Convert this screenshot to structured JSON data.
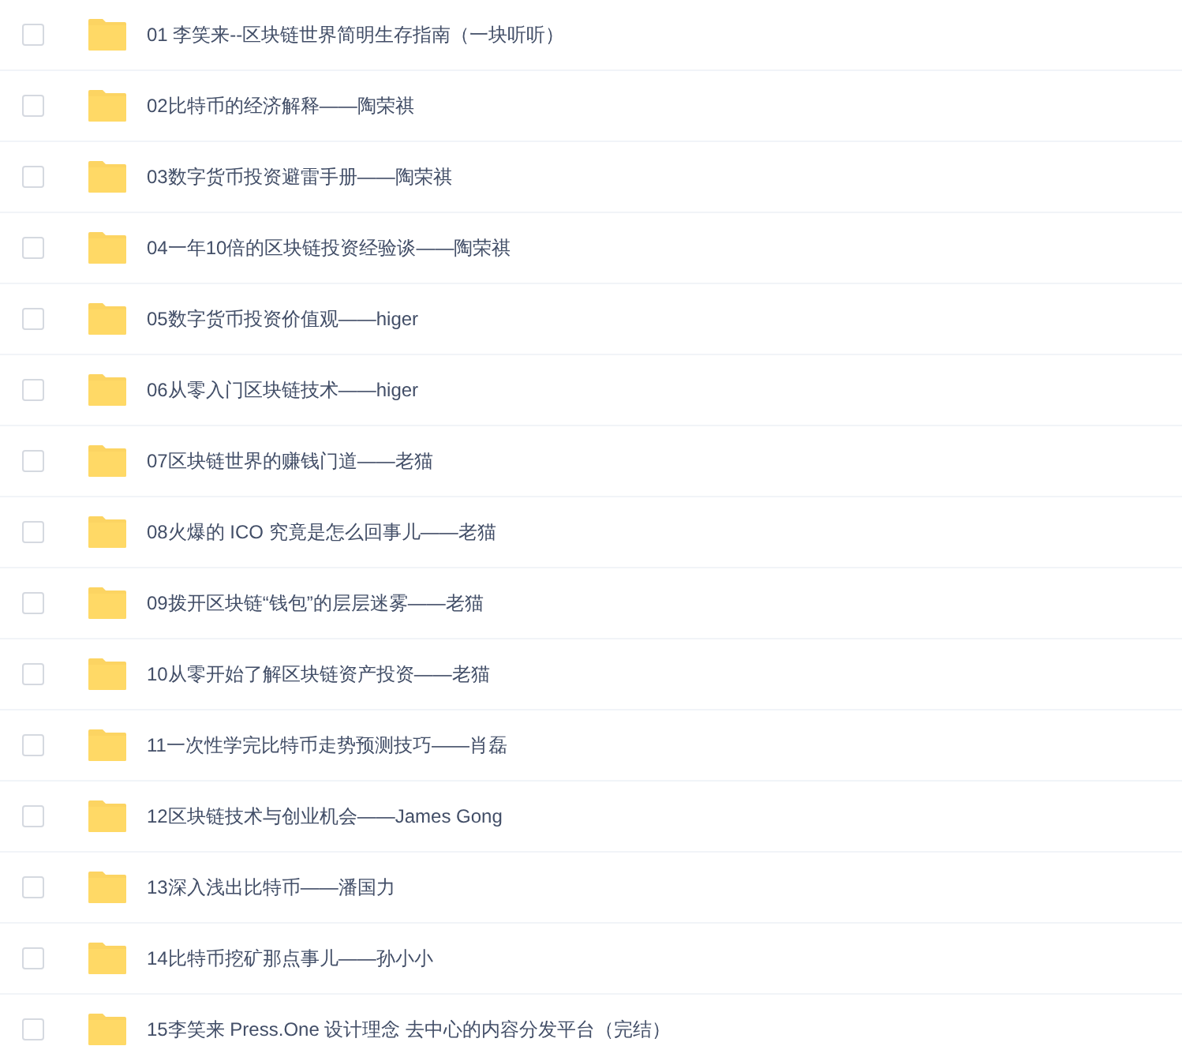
{
  "files": [
    {
      "name": "01 李笑来--区块链世界简明生存指南（一块听听）",
      "checked": false
    },
    {
      "name": "02比特币的经济解释——陶荣祺",
      "checked": false
    },
    {
      "name": "03数字货币投资避雷手册——陶荣祺",
      "checked": false
    },
    {
      "name": "04一年10倍的区块链投资经验谈——陶荣祺",
      "checked": false
    },
    {
      "name": "05数字货币投资价值观——higer",
      "checked": false
    },
    {
      "name": "06从零入门区块链技术——higer",
      "checked": false
    },
    {
      "name": "07区块链世界的赚钱门道——老猫",
      "checked": false
    },
    {
      "name": "08火爆的 ICO 究竟是怎么回事儿——老猫",
      "checked": false
    },
    {
      "name": "09拨开区块链“钱包”的层层迷雾——老猫",
      "checked": false
    },
    {
      "name": "10从零开始了解区块链资产投资——老猫",
      "checked": false
    },
    {
      "name": "11一次性学完比特币走势预测技巧——肖磊",
      "checked": false
    },
    {
      "name": "12区块链技术与创业机会——James Gong",
      "checked": false
    },
    {
      "name": "13深入浅出比特币——潘国力",
      "checked": false
    },
    {
      "name": "14比特币挖矿那点事儿——孙小小",
      "checked": false
    },
    {
      "name": "15李笑来 Press.One 设计理念 去中心的内容分发平台（完结）",
      "checked": false
    }
  ]
}
